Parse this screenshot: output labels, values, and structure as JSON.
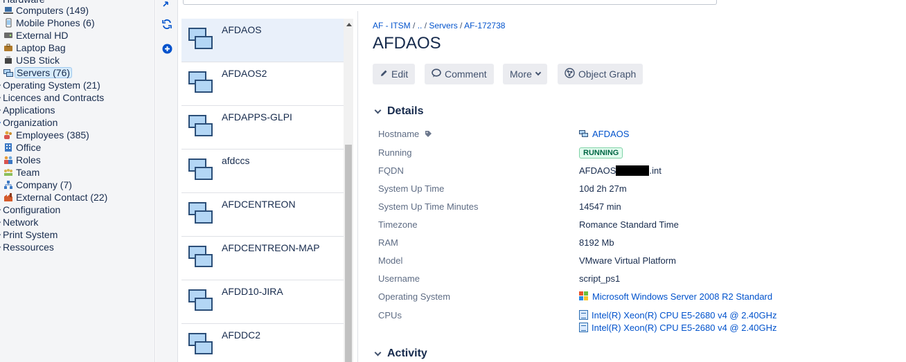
{
  "tree": {
    "hardware_partial": "Hardware",
    "items": [
      {
        "label": "Computers (149)",
        "icon": "laptop-icon"
      },
      {
        "label": "Mobile Phones (6)",
        "icon": "mobile-phone-icon"
      },
      {
        "label": "External HD",
        "icon": "hard-drive-icon"
      },
      {
        "label": "Laptop Bag",
        "icon": "bag-icon"
      },
      {
        "label": "USB Stick",
        "icon": "usb-stick-icon"
      },
      {
        "label": "Servers (76)",
        "icon": "server-icon",
        "selected": true
      },
      {
        "label": "Operating System (21)",
        "icon": "caret-icon"
      },
      {
        "label": "Licences and Contracts",
        "icon": "caret-icon"
      },
      {
        "label": "Applications",
        "icon": "caret-icon"
      },
      {
        "label": "Organization",
        "icon": "caret-icon"
      },
      {
        "label": "Employees (385)",
        "icon": "employees-icon"
      },
      {
        "label": "Office",
        "icon": "office-icon"
      },
      {
        "label": "Roles",
        "icon": "roles-icon"
      },
      {
        "label": "Team",
        "icon": "team-icon"
      },
      {
        "label": "Company (7)",
        "icon": "company-icon"
      },
      {
        "label": "External Contact (22)",
        "icon": "factory-icon"
      },
      {
        "label": "Configuration",
        "icon": "caret-icon"
      },
      {
        "label": "Network",
        "icon": "caret-icon"
      },
      {
        "label": "Print System",
        "icon": "caret-icon"
      },
      {
        "label": "Ressources",
        "icon": "caret-icon"
      }
    ]
  },
  "tools": {
    "icons": [
      "collapse-icon",
      "refresh-icon",
      "add-icon"
    ]
  },
  "list": {
    "items": [
      {
        "name": "AFDAOS",
        "selected": true
      },
      {
        "name": "AFDAOS2"
      },
      {
        "name": "AFDAPPS-GLPI"
      },
      {
        "name": "afdccs"
      },
      {
        "name": "AFDCENTREON"
      },
      {
        "name": "AFDCENTREON-MAP"
      },
      {
        "name": "AFDD10-JIRA"
      },
      {
        "name": "AFDDC2"
      }
    ]
  },
  "detail": {
    "breadcrumb": {
      "part1": "AF - ITSM",
      "sep1": " / ",
      "part2": "..",
      "sep2": " / ",
      "part3": "Servers",
      "sep3": " / ",
      "part4": "AF-172738"
    },
    "title": "AFDAOS",
    "buttons": {
      "edit": "Edit",
      "comment": "Comment",
      "more": "More",
      "graph": "Object Graph"
    },
    "details_heading": "Details",
    "activity_heading": "Activity",
    "rows": {
      "hostname_label": "Hostname",
      "hostname_value": "AFDAOS",
      "running_label": "Running",
      "running_value": "RUNNING",
      "fqdn_label": "FQDN",
      "fqdn_prefix": "AFDAOS",
      "fqdn_suffix": ".int",
      "uptime_label": "System Up Time",
      "uptime_value": "10d 2h 27m",
      "uptime_min_label": "System Up Time Minutes",
      "uptime_min_value": "14547 min",
      "tz_label": "Timezone",
      "tz_value": "Romance Standard Time",
      "ram_label": "RAM",
      "ram_value": "8192 Mb",
      "model_label": "Model",
      "model_value": "VMware Virtual Platform",
      "username_label": "Username",
      "username_value": "script_ps1",
      "os_label": "Operating System",
      "os_value": "Microsoft Windows Server 2008 R2 Standard",
      "cpus_label": "CPUs",
      "cpu1": "Intel(R) Xeon(R) CPU E5-2680 v4 @ 2.40GHz",
      "cpu2": "Intel(R) Xeon(R) CPU E5-2680 v4 @ 2.40GHz"
    }
  }
}
